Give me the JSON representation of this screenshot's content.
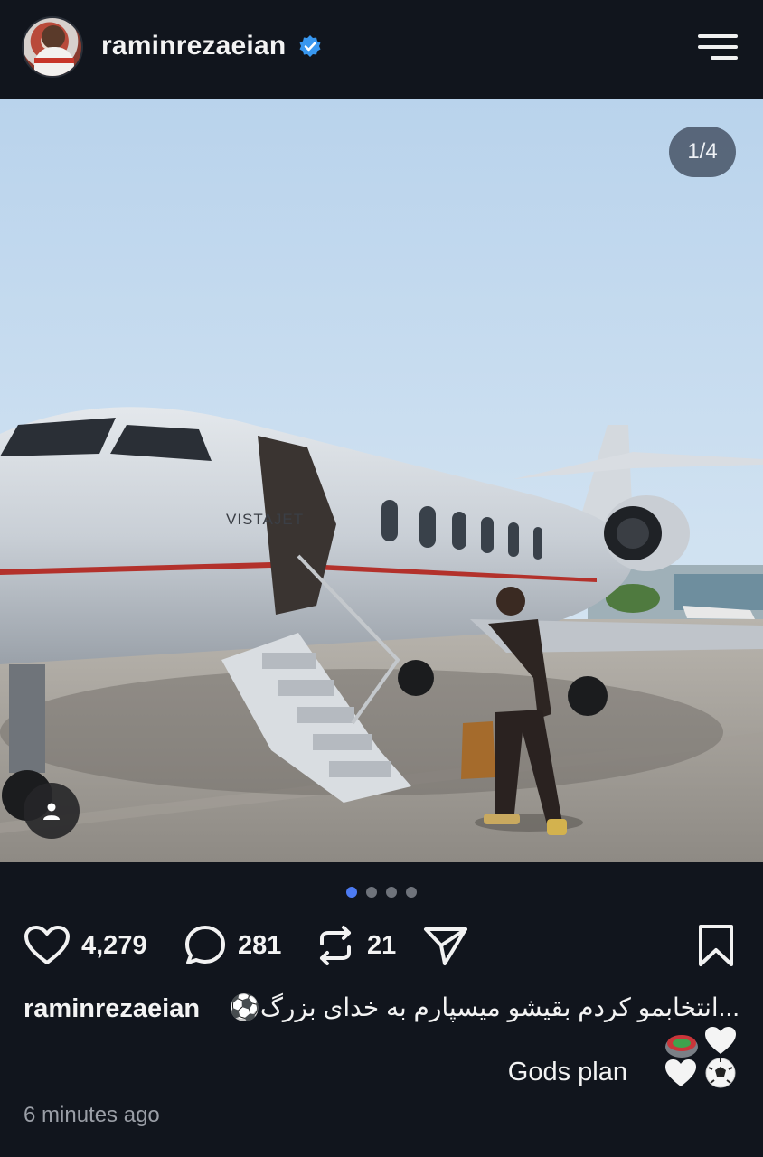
{
  "header": {
    "username": "raminrezaeian",
    "verified": true,
    "menu_icon": "hamburger-menu-icon"
  },
  "post": {
    "carousel_counter": "1/4",
    "carousel_total": 4,
    "carousel_active_index": 1,
    "image_text": "VISTAJET",
    "likes": "4,279",
    "comments": "281",
    "reposts": "21"
  },
  "caption": {
    "username": "raminrezaeian",
    "text": "⚽️انتخابمو کردم بقیشو میسپارم به خدای بزرگ...",
    "line2": "Gods plan"
  },
  "meta": {
    "time_ago": "6 minutes ago"
  },
  "colors": {
    "background": "#11151d",
    "accent_dot": "#4d7bf3",
    "verified_badge": "#3897f0"
  }
}
